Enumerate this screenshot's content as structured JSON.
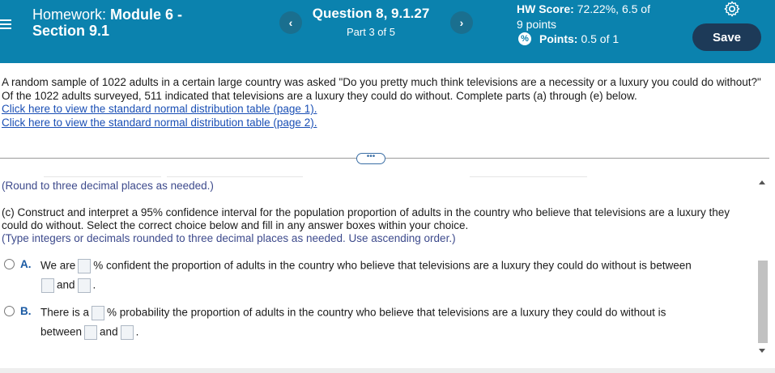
{
  "header": {
    "assignment_label": "Homework:",
    "assignment_name": "Module 6 -",
    "section": "Section 9.1",
    "question_title": "Question 8, 9.1.27",
    "question_part": "Part 3 of 5",
    "prev_glyph": "‹",
    "next_glyph": "›",
    "hw_score_label": "HW Score:",
    "hw_score_value": "72.22%, 6.5 of",
    "hw_score_points": "9 points",
    "points_label": "Points:",
    "points_value": "0.5 of 1",
    "save_label": "Save",
    "colors": {
      "header_bg": "#0b82ae",
      "save_bg": "#1d3a58"
    }
  },
  "intro": {
    "text": "A random sample of 1022 adults in a certain large country was asked \"Do you pretty much think televisions are a necessity or a luxury you could do without?\" Of the 1022 adults surveyed, 511 indicated that televisions are a luxury they could do without. Complete parts (a) through (e) below.",
    "link1": "Click here to view the standard normal distribution table (page 1).",
    "link2": "Click here to view the standard normal distribution table (page 2)."
  },
  "expand_glyph": "•••",
  "content": {
    "round_note": "(Round to three decimal places as needed.)",
    "part_c": "(c) Construct and interpret a 95% confidence interval for the population proportion of adults in the country who believe that televisions are a luxury they could do without. Select the correct choice below and fill in any answer boxes within your choice.",
    "type_note": "(Type integers or decimals rounded to three decimal places as needed. Use ascending order.)",
    "choice_a": {
      "letter": "A.",
      "pre": "We are",
      "mid": "% confident the proportion of adults in the country who believe that televisions are a luxury they could do without is between",
      "and": "and",
      "end": "."
    },
    "choice_b": {
      "letter": "B.",
      "pre": "There is a",
      "mid": "% probability the proportion of adults in the country who believe that televisions are a luxury they could do without is",
      "between": "between",
      "and": "and",
      "end": "."
    }
  }
}
